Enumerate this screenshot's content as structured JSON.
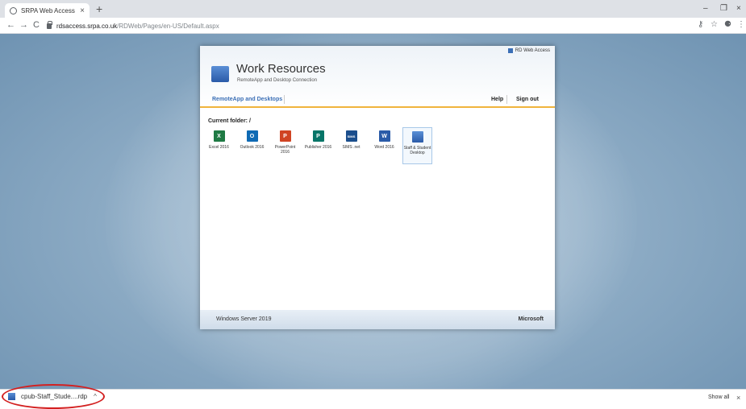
{
  "browser": {
    "tab_title": "SRPA Web Access",
    "tab_close": "×",
    "new_tab": "+",
    "url_host": "rdsaccess.srpa.co.uk",
    "url_path": "/RDWeb/Pages/en-US/Default.aspx",
    "back": "←",
    "forward": "→",
    "reload": "C",
    "key_icon": "⚷",
    "star_icon": "☆",
    "account_icon": "⚈",
    "menu_icon": "⋮",
    "minimize": "–",
    "maximize": "❐",
    "close": "×"
  },
  "rdweb": {
    "web_access_label": "RD Web Access",
    "title": "Work Resources",
    "subtitle": "RemoteApp and Desktop Connection",
    "nav_main": "RemoteApp and Desktops",
    "nav_help": "Help",
    "nav_signout": "Sign out",
    "current_folder": "Current folder: /",
    "apps": [
      {
        "label": "Excel 2016",
        "glyph": "X",
        "color": "#1f7a44"
      },
      {
        "label": "Outlook 2016",
        "glyph": "O",
        "color": "#0f6ab4"
      },
      {
        "label": "PowerPoint 2016",
        "glyph": "P",
        "color": "#d04423"
      },
      {
        "label": "Publisher 2016",
        "glyph": "P",
        "color": "#077568"
      },
      {
        "label": "SIMS .net",
        "glyph": "SIMS",
        "color": "#1b4e8c"
      },
      {
        "label": "Word 2016",
        "glyph": "W",
        "color": "#2a5ba8"
      },
      {
        "label": "Staff & Student Desktop",
        "glyph": "",
        "color": "#3b6fb6"
      }
    ],
    "footer_left": "Windows Server 2019",
    "footer_right": "Microsoft"
  },
  "downloads": {
    "file_name": "cpub-Staff_Stude....rdp",
    "chevron": "^",
    "show_all": "Show all",
    "close": "×"
  }
}
